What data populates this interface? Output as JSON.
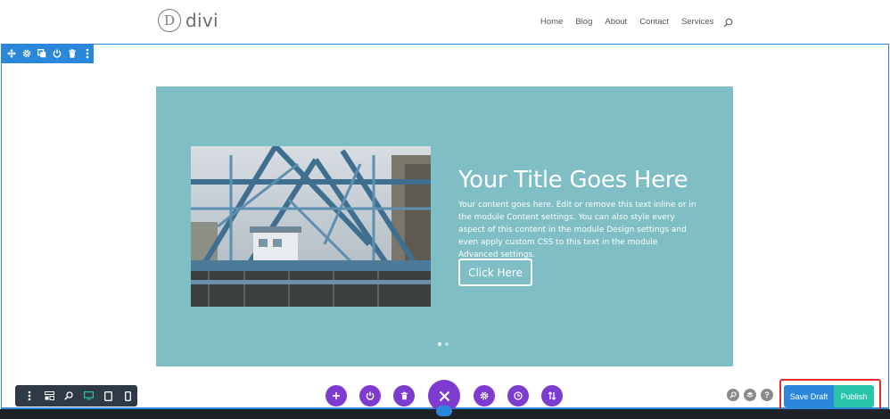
{
  "logo": {
    "mark": "D",
    "text": "divi"
  },
  "nav": {
    "items": [
      "Home",
      "Blog",
      "About",
      "Contact",
      "Services"
    ]
  },
  "section_toolbar": {
    "icons": [
      "move-icon",
      "gear-icon",
      "duplicate-icon",
      "power-icon",
      "trash-icon",
      "more-icon"
    ]
  },
  "slider": {
    "title": "Your Title Goes Here",
    "body": "Your content goes here. Edit or remove this text inline or in the module Content settings. You can also style every aspect of this content in the module Design settings and even apply custom CSS to this text in the module Advanced settings.",
    "button_label": "Click Here",
    "active_slide": 1,
    "slide_count": 2
  },
  "view_toolbar": {
    "icons": [
      "more-icon",
      "wireframe-icon",
      "zoom-icon",
      "desktop-icon",
      "tablet-icon",
      "phone-icon"
    ]
  },
  "actions": {
    "icons": [
      "add-icon",
      "power-icon",
      "trash-icon",
      "close-icon",
      "gear-icon",
      "history-icon",
      "sort-icon"
    ]
  },
  "right_tools": {
    "icons": [
      "search-icon",
      "layers-icon",
      "help-icon"
    ],
    "help_label": "?"
  },
  "buttons": {
    "save_draft": "Save Draft",
    "publish": "Publish"
  },
  "colors": {
    "accent_blue": "#2b87da",
    "accent_purple": "#7e3bd0",
    "publish_green": "#29c4a9",
    "slider_bg": "#7fbec4",
    "highlight_red": "#e52a2a"
  }
}
